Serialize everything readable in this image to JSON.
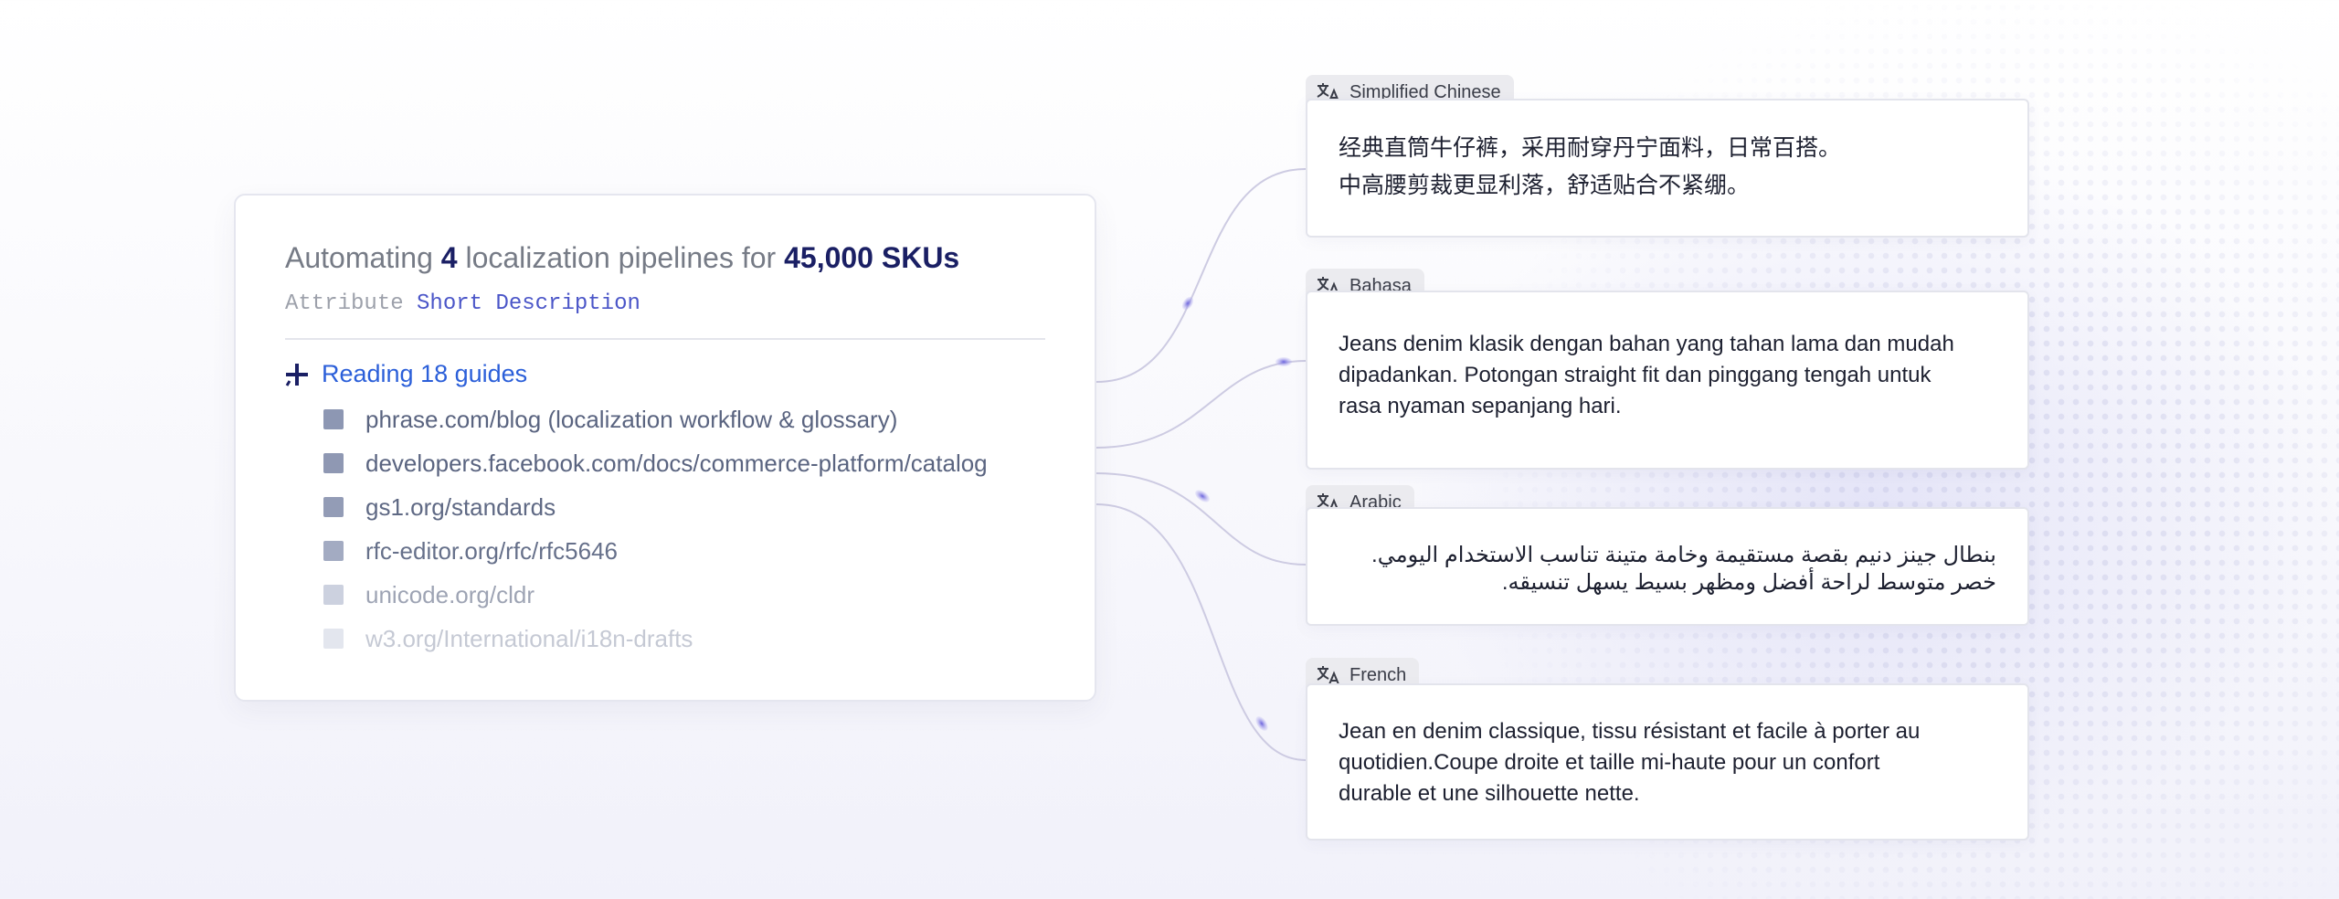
{
  "summary": {
    "prefix": "Automating",
    "count": "4",
    "middle": "localization pipelines for",
    "skus": "45,000 SKUs",
    "attribute_label": "Attribute",
    "attribute_value": "Short Description"
  },
  "reading": {
    "label": "Reading 18 guides",
    "guides": [
      {
        "text": "phrase.com/blog (localization workflow & glossary)",
        "color": "#5a6480"
      },
      {
        "text": "developers.facebook.com/docs/commerce-platform/catalog",
        "color": "#5a6480"
      },
      {
        "text": "gs1.org/standards",
        "color": "#5f6984"
      },
      {
        "text": "rfc-editor.org/rfc/rfc5646",
        "color": "#66708a"
      },
      {
        "text": "unicode.org/cldr",
        "color": "#9ea4b4"
      },
      {
        "text": "w3.org/International/i18n-drafts",
        "color": "#c5c9d4"
      }
    ]
  },
  "translations": [
    {
      "language": "Simplified Chinese",
      "lines": [
        "经典直筒牛仔裤，采用耐穿丹宁面料，日常百搭。",
        "中高腰剪裁更显利落，舒适贴合不紧绷。"
      ]
    },
    {
      "language": "Bahasa",
      "lines": [
        "Jeans denim klasik dengan bahan yang tahan lama dan mudah",
        "dipadankan. Potongan straight fit dan pinggang tengah untuk",
        "rasa nyaman sepanjang hari."
      ]
    },
    {
      "language": "Arabic",
      "lines": [
        "بنطال جينز دنيم بقصة مستقيمة وخامة متينة تناسب الاستخدام اليومي.",
        "خصر متوسط لراحة أفضل ومظهر بسيط يسهل تنسيقه."
      ]
    },
    {
      "language": "French",
      "lines": [
        "Jean en denim classique, tissu résistant et facile à porter au",
        "quotidien.Coupe droite et taille mi-haute pour un confort",
        "durable et une silhouette nette."
      ]
    }
  ],
  "colors": {
    "accent_navy": "#1a1f64",
    "accent_blue": "#2b5fd9",
    "attribute_value": "#4b56c8",
    "connector": "#c8c6e0",
    "connector_dot": "#7a72e0"
  },
  "icons": {
    "reading": "sparkle-plus-icon",
    "language": "translate-icon",
    "guide": "square-bullet-icon"
  }
}
